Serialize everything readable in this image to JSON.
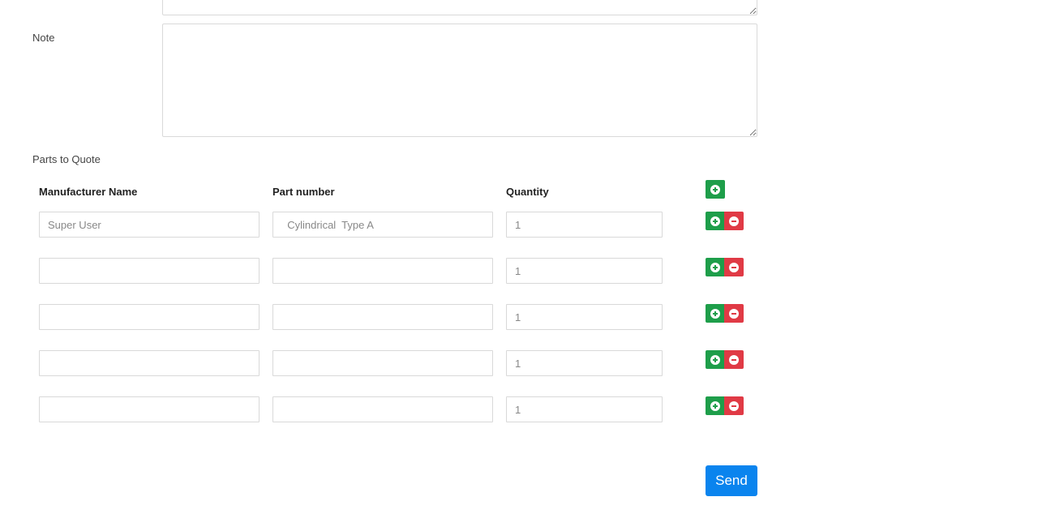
{
  "form": {
    "note_label": "Note",
    "note_value": "",
    "parts_label": "Parts to Quote",
    "send_label": "Send"
  },
  "table": {
    "headers": {
      "manufacturer": "Manufacturer Name",
      "part_number": "Part number",
      "quantity": "Quantity"
    },
    "rows": [
      {
        "manufacturer": "",
        "manufacturer_placeholder": "Super User",
        "part_number": "",
        "part_number_placeholder": "  Cylindrical  Type A",
        "quantity": "",
        "quantity_placeholder": "1"
      },
      {
        "manufacturer": "",
        "manufacturer_placeholder": "",
        "part_number": "",
        "part_number_placeholder": "",
        "quantity": "",
        "quantity_placeholder": "1"
      },
      {
        "manufacturer": "",
        "manufacturer_placeholder": "",
        "part_number": "",
        "part_number_placeholder": "",
        "quantity": "",
        "quantity_placeholder": "1"
      },
      {
        "manufacturer": "",
        "manufacturer_placeholder": "",
        "part_number": "",
        "part_number_placeholder": "",
        "quantity": "",
        "quantity_placeholder": "1"
      },
      {
        "manufacturer": "",
        "manufacturer_placeholder": "",
        "part_number": "",
        "part_number_placeholder": "",
        "quantity": "",
        "quantity_placeholder": "1"
      }
    ]
  },
  "icons": {
    "add": "plus-circle-icon",
    "remove": "minus-circle-icon"
  },
  "colors": {
    "add_button": "#1e9e4a",
    "remove_button": "#e03a45",
    "send_button": "#0a84ee"
  }
}
